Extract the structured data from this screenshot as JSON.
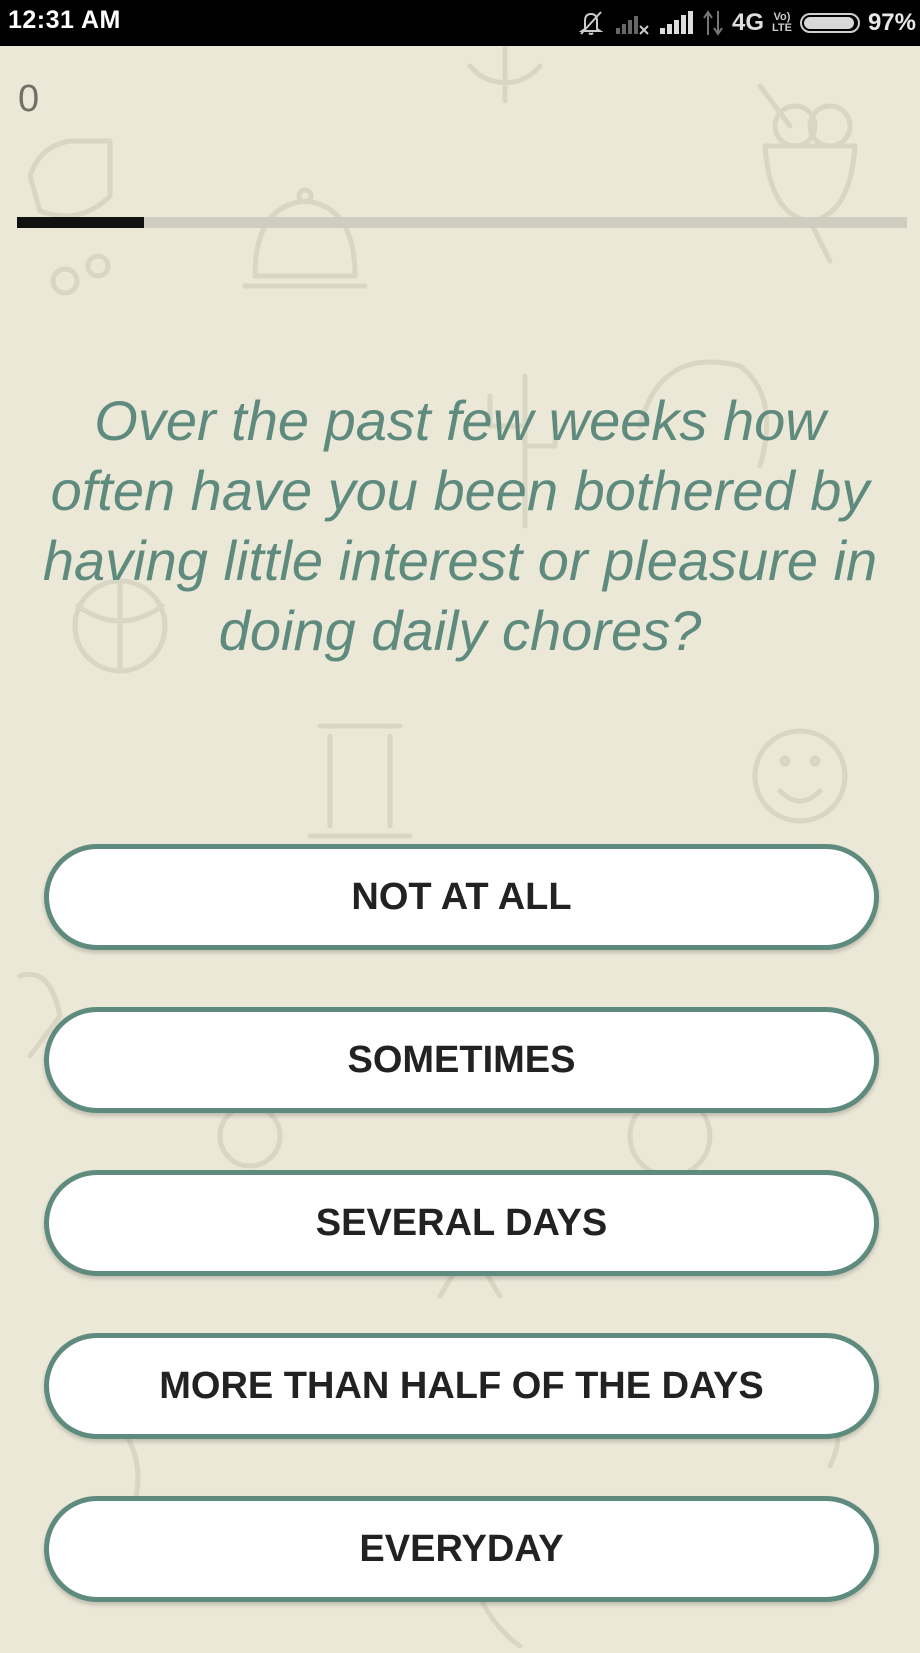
{
  "status_bar": {
    "time": "12:31 AM",
    "network": "4G",
    "volte_top": "Vo)",
    "volte_bottom": "LTE",
    "battery_percent": "97%",
    "battery_level": 0.97,
    "icons": [
      "mute-icon",
      "signal-no-sim-icon",
      "signal-icon",
      "data-arrows-icon",
      "volte-icon",
      "battery-icon"
    ]
  },
  "quiz": {
    "score": "0",
    "progress_fraction": 0.143,
    "question": "Over the past few weeks how often have you been bothered by having little interest or pleasure in doing daily chores?"
  },
  "answers": [
    {
      "label": "NOT AT ALL"
    },
    {
      "label": "SOMETIMES"
    },
    {
      "label": "SEVERAL DAYS"
    },
    {
      "label": "MORE THAN HALF OF THE DAYS"
    },
    {
      "label": "EVERYDAY"
    }
  ],
  "colors": {
    "background": "#ebe8d7",
    "accent": "#5e8b7e",
    "progress": "#111111",
    "button_bg": "#ffffff"
  }
}
